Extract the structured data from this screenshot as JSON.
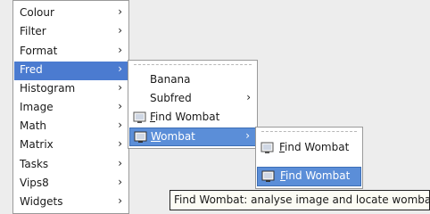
{
  "main_menu": {
    "items": [
      {
        "label": "Colour"
      },
      {
        "label": "Filter"
      },
      {
        "label": "Format"
      },
      {
        "label": "Fred"
      },
      {
        "label": "Histogram"
      },
      {
        "label": "Image"
      },
      {
        "label": "Math"
      },
      {
        "label": "Matrix"
      },
      {
        "label": "Tasks"
      },
      {
        "label": "Vips8"
      },
      {
        "label": "Widgets"
      }
    ],
    "arrow": "›",
    "selected": "Fred"
  },
  "fred_menu": {
    "banana": "Banana",
    "subfred": "Subfred",
    "find_wombat": "Find Wombat",
    "find_wombat_mnemonic": "F",
    "find_wombat_rest": "ind Wombat",
    "wombat_mnemonic": "W",
    "wombat_rest": "ombat",
    "selected": "Wombat"
  },
  "wombat_menu": {
    "find_wombat_mnemonic": "F",
    "find_wombat_rest": "ind Wombat",
    "selected": "Find Wombat"
  },
  "tooltip": {
    "text": "Find Wombat: analyse image and locate wombat"
  },
  "colors": {
    "selection": "#4b7bd0",
    "menu_bg": "#ffffff",
    "tooltip_bg": "#fcfcf4"
  },
  "icons": [
    "action-icon"
  ]
}
